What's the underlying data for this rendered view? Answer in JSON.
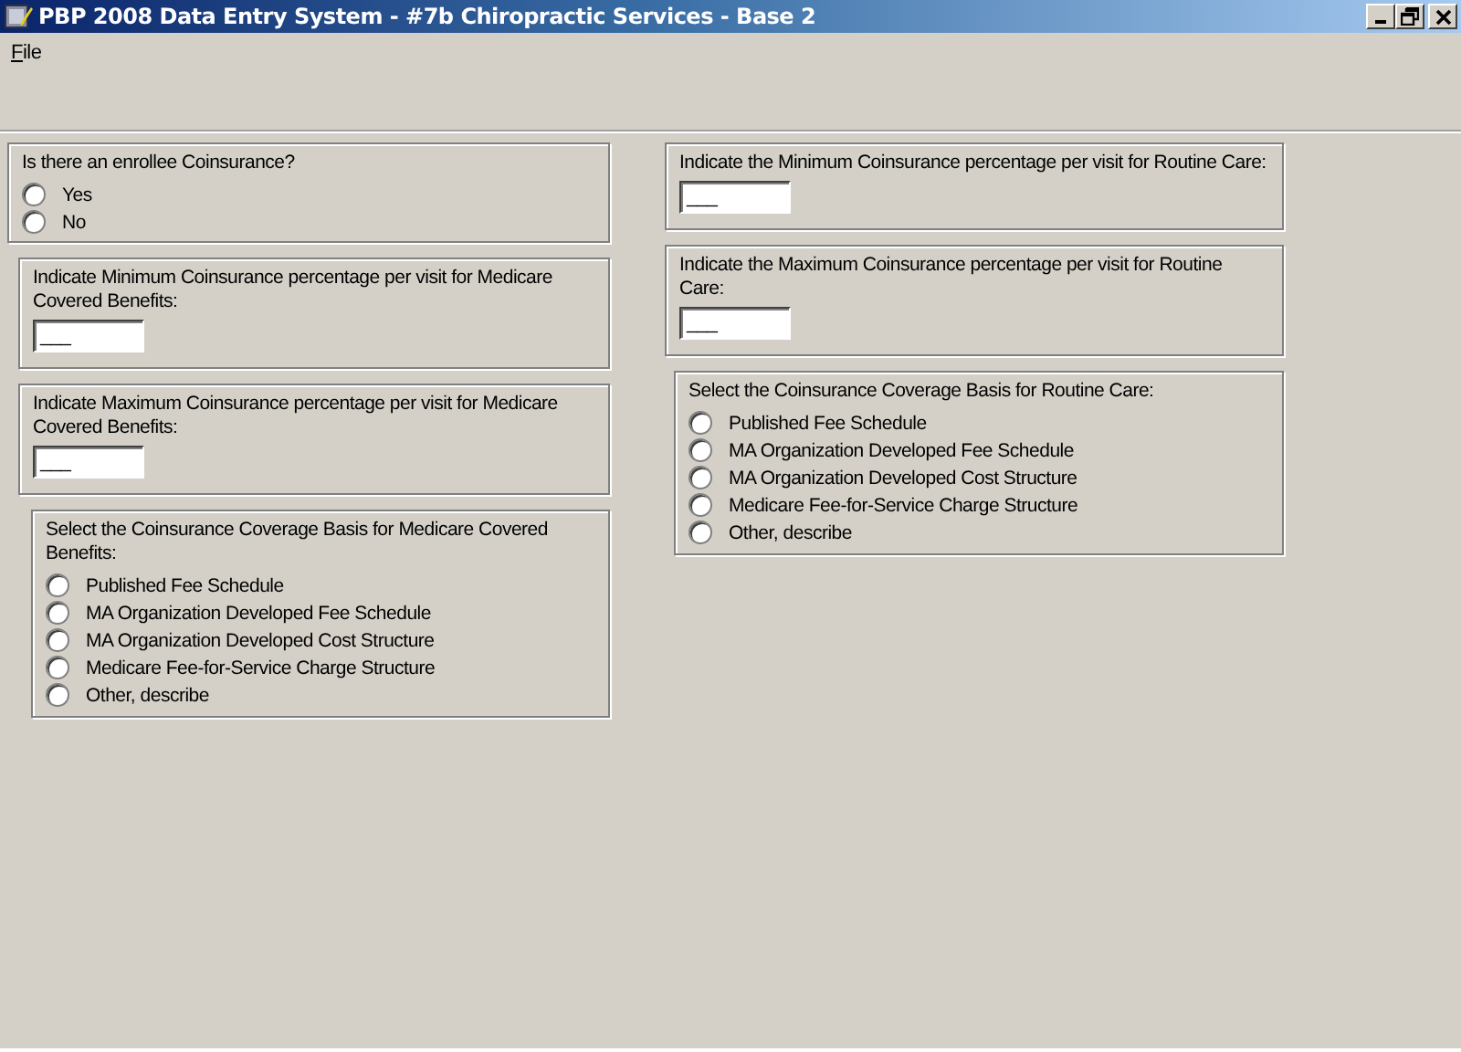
{
  "window": {
    "title": "PBP 2008 Data Entry System - #7b Chiropractic Services - Base 2"
  },
  "menu": [
    {
      "label": "File"
    }
  ],
  "columns": [
    {
      "panels": [
        {
          "kind": "radio",
          "question": "Is there an enrollee Coinsurance?",
          "options": [
            {
              "label": "Yes",
              "selected": false
            },
            {
              "label": "No",
              "selected": false
            }
          ]
        },
        {
          "kind": "field",
          "question": "Indicate Minimum Coinsurance percentage per visit for Medicare Covered Benefits:",
          "value": "___"
        },
        {
          "kind": "field",
          "question": "Indicate Maximum Coinsurance percentage per visit for Medicare Covered Benefits:",
          "value": "___"
        },
        {
          "kind": "radio",
          "question": "Select the Coinsurance Coverage Basis for Medicare Covered Benefits:",
          "options": [
            {
              "label": "Published Fee Schedule",
              "selected": false
            },
            {
              "label": "MA Organization Developed Fee Schedule",
              "selected": false
            },
            {
              "label": "MA Organization Developed Cost Structure",
              "selected": false
            },
            {
              "label": "Medicare Fee-for-Service Charge Structure",
              "selected": false
            },
            {
              "label": "Other, describe",
              "selected": false
            }
          ]
        }
      ]
    },
    {
      "panels": [
        {
          "kind": "field",
          "question": "Indicate the Minimum Coinsurance percentage per visit for Routine Care:",
          "value": "___"
        },
        {
          "kind": "field",
          "question": "Indicate the Maximum Coinsurance percentage per visit for Routine Care:",
          "value": "___"
        },
        {
          "kind": "radio",
          "question": "Select the Coinsurance Coverage Basis for Routine Care:",
          "options": [
            {
              "label": "Published Fee Schedule",
              "selected": false
            },
            {
              "label": "MA Organization Developed Fee Schedule",
              "selected": false
            },
            {
              "label": "MA Organization Developed Cost Structure",
              "selected": false
            },
            {
              "label": "Medicare Fee-for-Service Charge Structure",
              "selected": false
            },
            {
              "label": "Other, describe",
              "selected": false
            }
          ]
        }
      ]
    }
  ]
}
